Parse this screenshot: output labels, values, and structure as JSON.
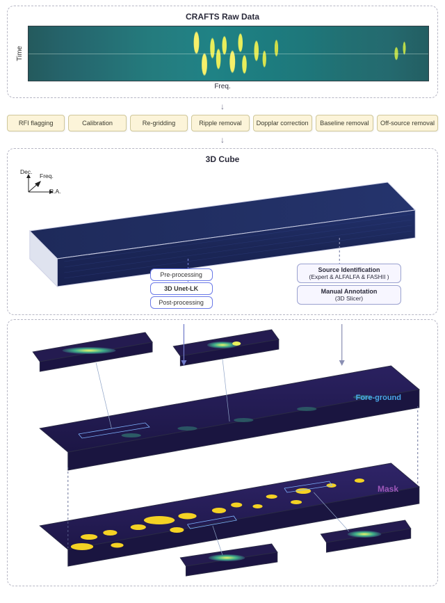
{
  "raw_panel": {
    "title": "CRAFTS Raw Data",
    "ylabel": "Time",
    "xlabel": "Freq."
  },
  "pipeline_steps": [
    "RFI flagging",
    "Calibration",
    "Re-gridding",
    "Ripple removal",
    "Dopplar correction",
    "Baseline removal",
    "Off-source removal"
  ],
  "cube_panel": {
    "title": "3D Cube",
    "axes": {
      "z": "Dec.",
      "y": "Freq.",
      "x": "R.A."
    }
  },
  "flow_left": {
    "pre": "Pre-processing",
    "main": "3D Unet-LK",
    "post": "Post-processing"
  },
  "flow_right": {
    "top_title": "Source Identification",
    "top_paren": "(Expert & ALFALFA & FASHII )",
    "bottom_title": "Manual Annotation",
    "bottom_paren": "(3D Slicer)"
  },
  "results": {
    "foreground_label": "Fore-ground",
    "mask_label": "Mask"
  }
}
